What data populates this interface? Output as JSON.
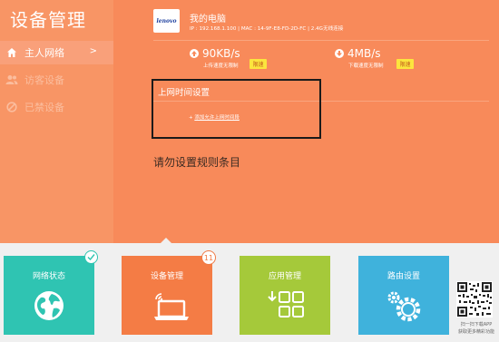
{
  "app": {
    "title": "设备管理"
  },
  "sidebar": {
    "items": [
      {
        "label": "主人网络",
        "icon": "home-icon",
        "active": true,
        "arrow": ">"
      },
      {
        "label": "访客设备",
        "icon": "users-icon",
        "active": false
      },
      {
        "label": "已禁设备",
        "icon": "ban-icon",
        "active": false
      }
    ]
  },
  "device": {
    "logo_text": "lenovo",
    "name": "我的电脑",
    "info": "IP : 192.168.1.100 | MAC : 14-9F-E8-FD-2D-FC | 2.4G无线连接"
  },
  "speeds": {
    "upload": {
      "value": "90KB/s",
      "sub": "上传速度无限制",
      "limit_label": "限速",
      "icon": "upload-arrow-icon"
    },
    "download": {
      "value": "4MB/s",
      "sub": "下载速度无限制",
      "limit_label": "限速",
      "icon": "download-arrow-icon"
    }
  },
  "schedule": {
    "title": "上网时间设置",
    "add_prefix": "+",
    "add_link": "添加允许上网时间段",
    "empty_message": "请勿设置规则条目"
  },
  "tiles": [
    {
      "label": "网络状态",
      "color": "#2fc4b2",
      "icon": "globe-icon"
    },
    {
      "label": "设备管理",
      "color": "#f47c45",
      "icon": "laptop-wifi-icon",
      "badge": "11"
    },
    {
      "label": "应用管理",
      "color": "#a5c93a",
      "icon": "apps-grid-icon"
    },
    {
      "label": "路由设置",
      "color": "#3fb2dc",
      "icon": "gear-icon"
    }
  ],
  "qr": {
    "caption": "扫一扫下载APP\n获取更多精彩功能"
  },
  "colors": {
    "top_bg": "#f88a5a",
    "sidebar_bg": "#f89565",
    "limit_yellow": "#fce53e"
  }
}
